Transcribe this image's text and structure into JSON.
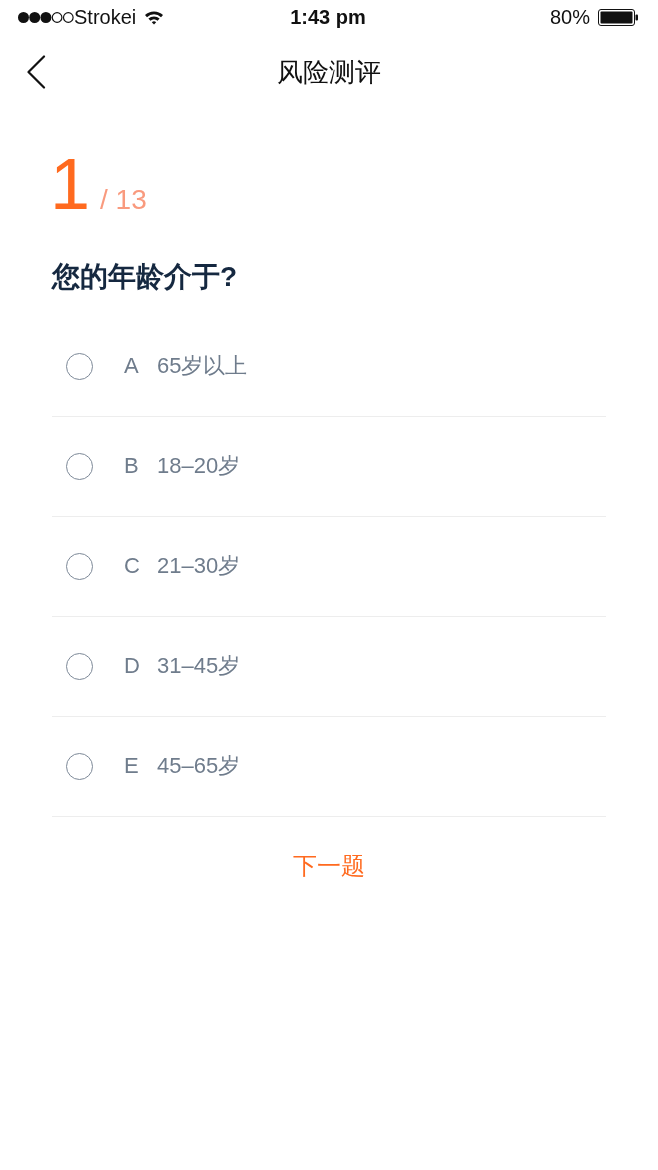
{
  "status_bar": {
    "carrier": "Strokei",
    "time": "1:43 pm",
    "battery": "80%"
  },
  "nav": {
    "title": "风险测评"
  },
  "progress": {
    "current": "1",
    "total": "/ 13"
  },
  "question": "您的年龄介于?",
  "options": [
    {
      "letter": "A",
      "text": "65岁以上",
      "selected": false
    },
    {
      "letter": "B",
      "text": "18–20岁",
      "selected": false
    },
    {
      "letter": "C",
      "text": "21–30岁",
      "selected": false
    },
    {
      "letter": "D",
      "text": "31–45岁",
      "selected": false
    },
    {
      "letter": "E",
      "text": "45–65岁",
      "selected": false
    }
  ],
  "next_button": "下一题"
}
